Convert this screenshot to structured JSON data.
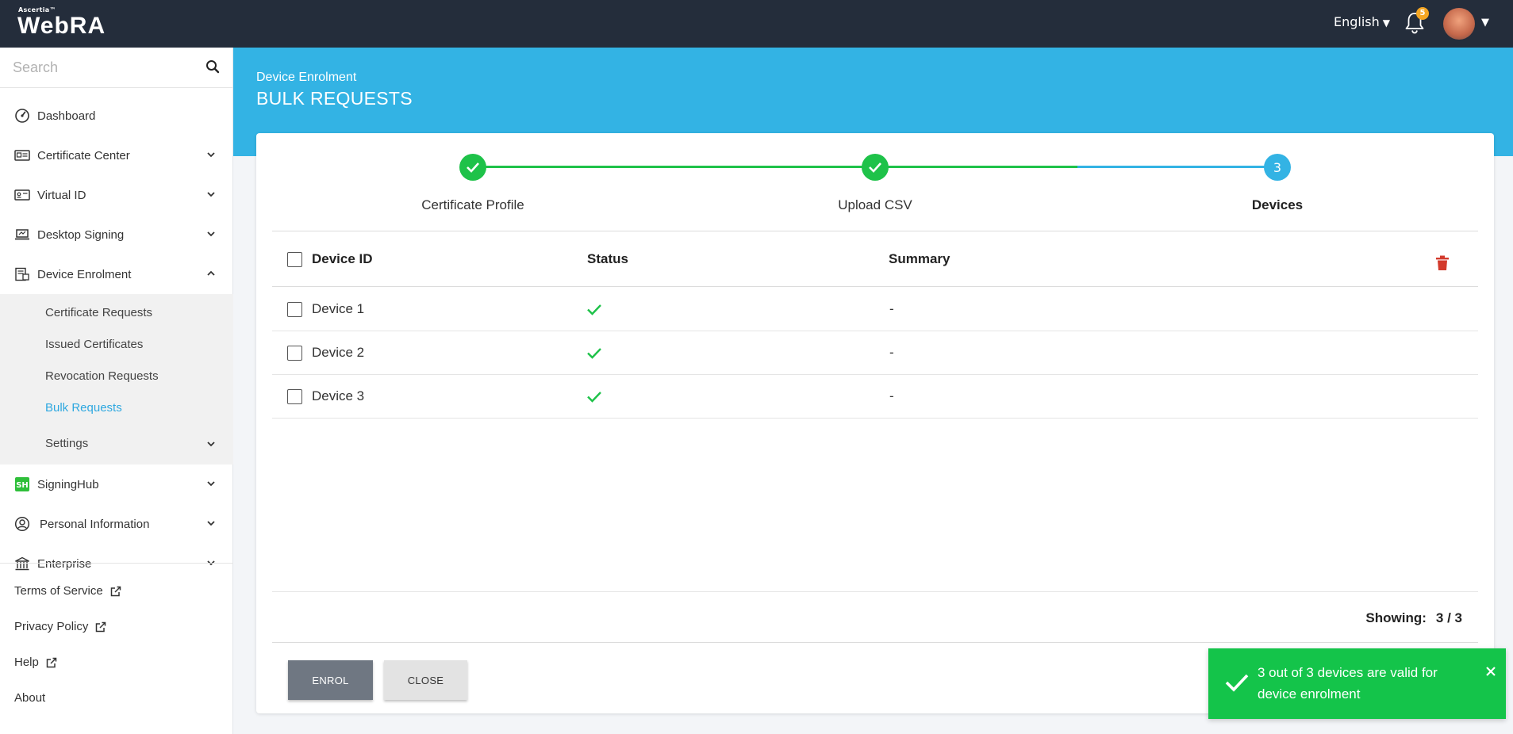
{
  "header": {
    "logo_small": "Ascertia™",
    "logo_text": "WebRA",
    "language": "English",
    "notification_count": "5"
  },
  "search": {
    "placeholder": "Search"
  },
  "sidebar": {
    "items": [
      {
        "label": "Dashboard"
      },
      {
        "label": "Certificate Center"
      },
      {
        "label": "Virtual ID"
      },
      {
        "label": "Desktop Signing"
      },
      {
        "label": "Device Enrolment"
      },
      {
        "label": "SigningHub"
      },
      {
        "label": "Personal Information"
      },
      {
        "label": "Enterprise"
      }
    ],
    "device_enrolment_sub": [
      {
        "label": "Certificate Requests"
      },
      {
        "label": "Issued Certificates"
      },
      {
        "label": "Revocation Requests"
      },
      {
        "label": "Bulk Requests"
      },
      {
        "label": "Settings"
      }
    ],
    "footer": [
      {
        "label": "Terms of Service"
      },
      {
        "label": "Privacy Policy"
      },
      {
        "label": "Help"
      },
      {
        "label": "About"
      }
    ]
  },
  "page": {
    "breadcrumb": "Device Enrolment",
    "title": "BULK REQUESTS"
  },
  "stepper": {
    "steps": [
      {
        "label": "Certificate Profile",
        "state": "done"
      },
      {
        "label": "Upload CSV",
        "state": "done"
      },
      {
        "label": "Devices",
        "state": "current",
        "number": "3"
      }
    ],
    "colors": {
      "done": "#1ec249",
      "current": "#33b3e4"
    }
  },
  "table": {
    "columns": [
      "Device ID",
      "Status",
      "Summary"
    ],
    "rows": [
      {
        "device_id": "Device 1",
        "status": "valid",
        "summary": "-"
      },
      {
        "device_id": "Device 2",
        "status": "valid",
        "summary": "-"
      },
      {
        "device_id": "Device 3",
        "status": "valid",
        "summary": "-"
      }
    ],
    "showing_label": "Showing:",
    "showing_value": "3 / 3"
  },
  "actions": {
    "enrol_label": "ENROL",
    "close_label": "CLOSE"
  },
  "toast": {
    "message": "3 out of 3 devices are valid for device enrolment",
    "color": "#14c44a"
  }
}
